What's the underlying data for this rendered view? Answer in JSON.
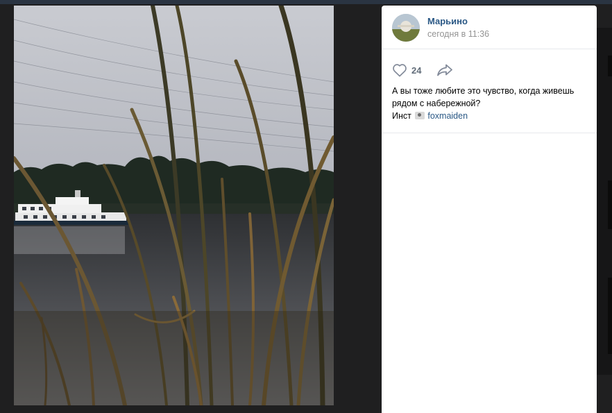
{
  "post": {
    "author": "Марьино",
    "date": "сегодня в 11:36",
    "likes": "24",
    "text_line1": "А вы тоже любите это чувство, когда живешь",
    "text_line2": "рядом с набережной?",
    "insta_label": "Инст",
    "insta_user": "foxmaiden"
  },
  "icons": {
    "like": "heart-icon",
    "share": "share-arrow-icon",
    "camera": "camera-emoji-icon"
  },
  "colors": {
    "link": "#2a5885",
    "muted": "#939393",
    "counter": "#626d7a",
    "backdrop": "#1f1f20"
  }
}
